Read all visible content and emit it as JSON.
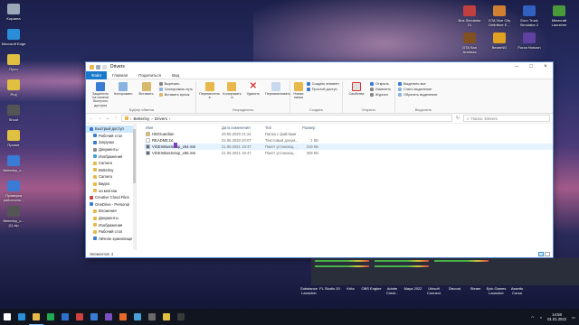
{
  "desktop": {
    "left_icons": [
      {
        "label": "Корзина",
        "color": "#9aa8b8"
      },
      {
        "label": "Microsoft Edge",
        "color": "#2a8fd8"
      },
      {
        "label": "Проч",
        "color": "#e0c040"
      },
      {
        "label": "Proj",
        "color": "#e0c040"
      },
      {
        "label": "Shoot",
        "color": "#555"
      },
      {
        "label": "Проект",
        "color": "#e0c040"
      },
      {
        "label": "Betterloy_c...",
        "color": "#3a7bd5"
      },
      {
        "label": "Проверка работоспо...",
        "color": "#3a7bd5"
      },
      {
        "label": "Betterloy_c... (1).zip",
        "color": "#555"
      }
    ],
    "right_icons": [
      {
        "label": "Bus Simulator 21",
        "color": "#c04040"
      },
      {
        "label": "GTA Vice City Definitive E...",
        "color": "#d08030"
      },
      {
        "label": "Euro Truck Simulator 2",
        "color": "#3060c0"
      },
      {
        "label": "Minecraft Launcher",
        "color": "#4a9a3a"
      },
      {
        "label": "GTA San Andreas",
        "color": "#805020"
      },
      {
        "label": "BeamNG",
        "color": "#e0a020"
      },
      {
        "label": "Forza Horizon",
        "color": "#6040a0"
      }
    ]
  },
  "explorer": {
    "title": "Drivers",
    "tabs": [
      "Файл",
      "Главная",
      "Поделиться",
      "Вид"
    ],
    "ribbon": {
      "clipboard": {
        "name": "Буфер обмена",
        "pin": "Закрепить на панели быстрого доступа",
        "copy": "Копировать",
        "paste": "Вставить",
        "cut": "Вырезать",
        "copy_path": "Скопировать путь",
        "paste_shortcut": "Вставить ярлык"
      },
      "organize": {
        "name": "Упорядочить",
        "move": "Переместить в",
        "copy_to": "Копировать в",
        "delete": "Удалить",
        "rename": "Переименовать"
      },
      "new": {
        "name": "Создать",
        "new_folder": "Новая папка",
        "new_item": "Создать элемент",
        "easy_access": "Простой доступ"
      },
      "open": {
        "name": "Открыть",
        "properties": "Свойства",
        "open": "Открыть",
        "edit": "Изменить",
        "history": "Журнал"
      },
      "select": {
        "name": "Выделить",
        "all": "Выделить все",
        "none": "Снять выделение",
        "invert": "Обратить выделение"
      }
    },
    "address": {
      "parts": [
        "Betterloy",
        "Drivers"
      ]
    },
    "search_placeholder": "Поиск: Drivers",
    "nav": [
      {
        "label": "Быстрый доступ",
        "color": "#3a7bd5",
        "sel": true,
        "sub": false
      },
      {
        "label": "Рабочий стол",
        "color": "#3a7bd5",
        "sel": false,
        "sub": true
      },
      {
        "label": "Загрузки",
        "color": "#3a7bd5",
        "sel": false,
        "sub": true
      },
      {
        "label": "Документы",
        "color": "#8a8a8a",
        "sel": false,
        "sub": true
      },
      {
        "label": "Изображения",
        "color": "#4aa0d8",
        "sel": false,
        "sub": true
      },
      {
        "label": "Camera",
        "color": "#e8b84a",
        "sel": false,
        "sub": true
      },
      {
        "label": "Betterloy",
        "color": "#e8b84a",
        "sel": false,
        "sub": true
      },
      {
        "label": "Camera",
        "color": "#e8b84a",
        "sel": false,
        "sub": true
      },
      {
        "label": "Видео",
        "color": "#e8b84a",
        "sel": false,
        "sub": true
      },
      {
        "label": "на монтаж",
        "color": "#e8b84a",
        "sel": false,
        "sub": true
      },
      {
        "label": "Creative Cloud Files",
        "color": "#d04040",
        "sel": false,
        "sub": false
      },
      {
        "label": "OneDrive - Personal",
        "color": "#3a7bd5",
        "sel": false,
        "sub": false
      },
      {
        "label": "Вложения",
        "color": "#e8b84a",
        "sel": false,
        "sub": true
      },
      {
        "label": "Документы",
        "color": "#e8b84a",
        "sel": false,
        "sub": true
      },
      {
        "label": "Изображения",
        "color": "#e8b84a",
        "sel": false,
        "sub": true
      },
      {
        "label": "Рабочий стол",
        "color": "#e8b84a",
        "sel": false,
        "sub": true
      },
      {
        "label": "Личное хранилище",
        "color": "#3a7bd5",
        "sel": false,
        "sub": true
      }
    ],
    "columns": {
      "name": "Имя",
      "date": "Дата изменения",
      "type": "Тип",
      "size": "Размер"
    },
    "files": [
      {
        "name": "HIDGuardian",
        "date": "29.05.2020 21:24",
        "type": "Папка с файлами",
        "size": "",
        "color": "#e8b84a",
        "hover": false
      },
      {
        "name": "README.txt",
        "date": "22.05.2020 20:07",
        "type": "Текстовый докум...",
        "size": "1 КБ",
        "color": "#ffffff",
        "hover": false
      },
      {
        "name": "ViGEmBusSetup_x64.msi",
        "date": "21.05.2021 19:47",
        "type": "Пакет установщ...",
        "size": "316 КБ",
        "color": "#5a6a8a",
        "hover": true
      },
      {
        "name": "ViGEmBusSetup_x86.msi",
        "date": "21.05.2021 19:47",
        "type": "Пакет установщ...",
        "size": "305 КБ",
        "color": "#5a6a8a",
        "hover": false
      }
    ],
    "status": "Элементов: 4"
  },
  "taskbar": {
    "apps": [
      "#2a8fd8",
      "#e8b84a",
      "#1faa52",
      "#2f6fd0",
      "#d04040",
      "#3a7bd5",
      "#7a4fc0",
      "#e86a2a",
      "#4aa0d8",
      "#6a6a6a",
      "#e0c040",
      "#3a3a3a"
    ],
    "bottom_labels": [
      "Substance Launcher",
      "FL Studio 20",
      "Krita",
      "OBS Engine",
      "Adobe Creat...",
      "Maya 2022",
      "Ubisoft Connect",
      "Discord",
      "Steam",
      "Epic Games Launcher",
      "Assetto Corsa"
    ],
    "time": "14:58",
    "date": "01.01.2022"
  }
}
